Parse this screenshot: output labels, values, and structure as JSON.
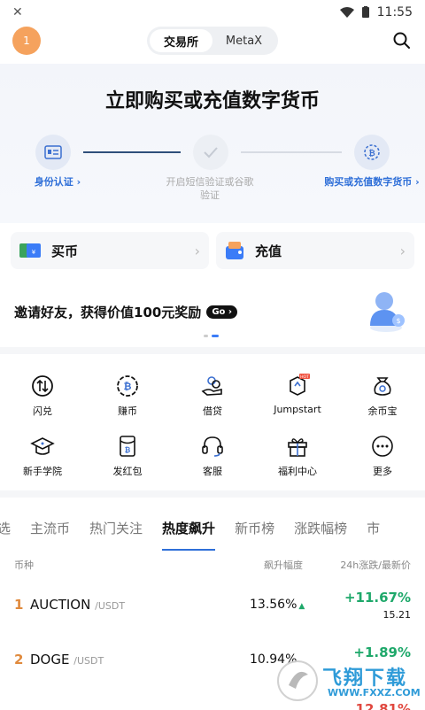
{
  "status": {
    "time": "11:55"
  },
  "header": {
    "avatar_text": "1",
    "tabs": [
      "交易所",
      "MetaX"
    ]
  },
  "hero": {
    "title": "立即购买或充值数字货币",
    "steps": [
      {
        "label": "身份认证 ›",
        "state": "active"
      },
      {
        "label": "开启短信验证或谷歌验证",
        "state": "inactive"
      },
      {
        "label": "购买或充值数字货币 ›",
        "state": "active"
      }
    ]
  },
  "quick": [
    {
      "label": "买币"
    },
    {
      "label": "充值"
    }
  ],
  "invite": {
    "text": "邀请好友，获得价值100元奖励",
    "badge": "Go ›"
  },
  "grid": [
    {
      "label": "闪兑",
      "icon": "swap-icon"
    },
    {
      "label": "赚币",
      "icon": "earn-icon"
    },
    {
      "label": "借贷",
      "icon": "loan-icon"
    },
    {
      "label": "Jumpstart",
      "icon": "jumpstart-icon",
      "badge": "HOT"
    },
    {
      "label": "余币宝",
      "icon": "savings-icon"
    },
    {
      "label": "新手学院",
      "icon": "academy-icon"
    },
    {
      "label": "发红包",
      "icon": "red-packet-icon"
    },
    {
      "label": "客服",
      "icon": "support-icon"
    },
    {
      "label": "福利中心",
      "icon": "gift-icon"
    },
    {
      "label": "更多",
      "icon": "more-icon"
    }
  ],
  "tabs": [
    "选",
    "主流币",
    "热门关注",
    "热度飙升",
    "新币榜",
    "涨跌幅榜",
    "市"
  ],
  "active_tab": 3,
  "table": {
    "headers": [
      "币种",
      "飙升幅度",
      "24h涨跌/最新价"
    ],
    "rows": [
      {
        "rank": "1",
        "base": "AUCTION",
        "quote": "/USDT",
        "heat": "13.56%",
        "change": "+11.67%",
        "price": "15.21"
      },
      {
        "rank": "2",
        "base": "DOGE",
        "quote": "/USDT",
        "heat": "10.94%",
        "change": "+1.89%",
        "price": ""
      }
    ],
    "partial_change": "12.81%"
  },
  "watermark": {
    "title": "飞翔下载",
    "url": "WWW.FXXZ.COM"
  },
  "colors": {
    "accent": "#2f6fd8",
    "green": "#1ea86a",
    "orange": "#f5a25d"
  }
}
